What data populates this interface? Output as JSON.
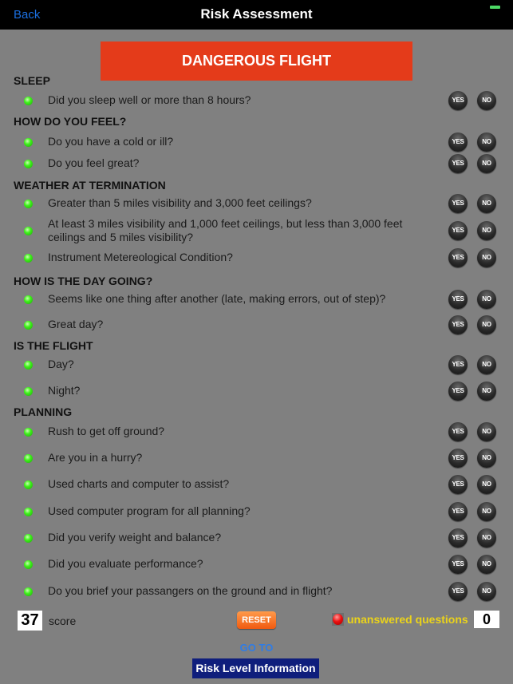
{
  "navbar": {
    "back_label": "Back",
    "title": "Risk Assessment",
    "battery_color": "#4cd964"
  },
  "banner": {
    "label": "DANGEROUS FLIGHT",
    "color": "#e43b1a"
  },
  "buttons": {
    "yes": "YES",
    "no": "NO"
  },
  "sections": [
    {
      "title": "SLEEP",
      "questions": [
        "Did you sleep well or more than 8 hours?"
      ]
    },
    {
      "title": "HOW DO YOU FEEL?",
      "questions": [
        "Do you have a cold or ill?",
        "Do you feel great?"
      ]
    },
    {
      "title": "WEATHER AT TERMINATION",
      "questions": [
        "Greater than 5 miles visibility and 3,000 feet ceilings?",
        "At least 3 miles visibility and 1,000 feet ceilings, but less than 3,000 feet ceilings and 5 miles visibility?",
        "Instrument Metereological Condition?"
      ]
    },
    {
      "title": "HOW IS THE DAY GOING?",
      "questions": [
        "Seems like one thing after another (late, making errors, out of step)?",
        "Great day?"
      ]
    },
    {
      "title": "IS THE FLIGHT",
      "questions": [
        "Day?",
        "Night?"
      ]
    },
    {
      "title": "PLANNING",
      "questions": [
        "Rush to get off ground?",
        "Are you in a hurry?",
        "Used charts and computer to assist?",
        "Used computer program for all planning?",
        "Did you verify weight and balance?",
        "Did you evaluate performance?",
        "Do you brief your passangers on the ground and in flight?"
      ]
    }
  ],
  "footer": {
    "score_value": "37",
    "score_label": "score",
    "reset_label": "RESET",
    "unanswered_label": "unanswered questions",
    "unanswered_value": "0",
    "goto_label": "GO TO",
    "risk_level_label": "Risk Level Information"
  }
}
